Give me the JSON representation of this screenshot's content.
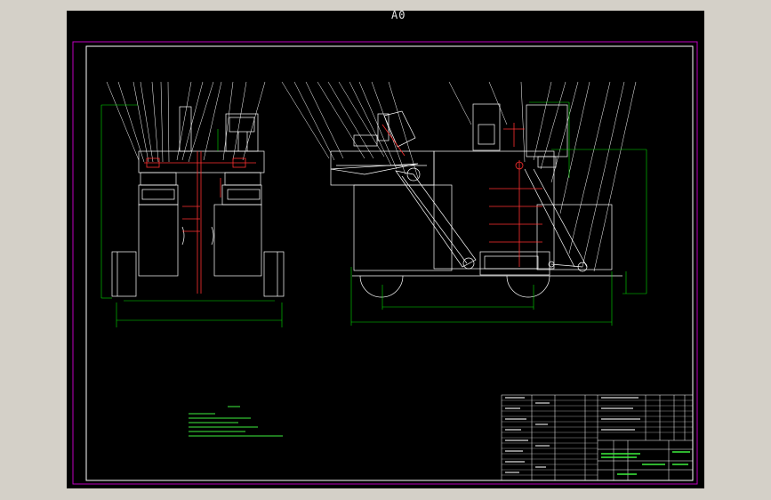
{
  "sheet": {
    "title": "A0",
    "background": "#000000",
    "frame_colors": {
      "outer_frame": "#c000c0",
      "inner_frame": "#ffffff",
      "geometry": "#ffffff",
      "dimensions": "#00e000",
      "centerlines": "#ff2020",
      "notes": "#3ef03e"
    }
  },
  "drawing": {
    "views": [
      "front-view",
      "side-view"
    ],
    "notes_block": "technical-requirements",
    "title_block": "drawing-title-block"
  }
}
